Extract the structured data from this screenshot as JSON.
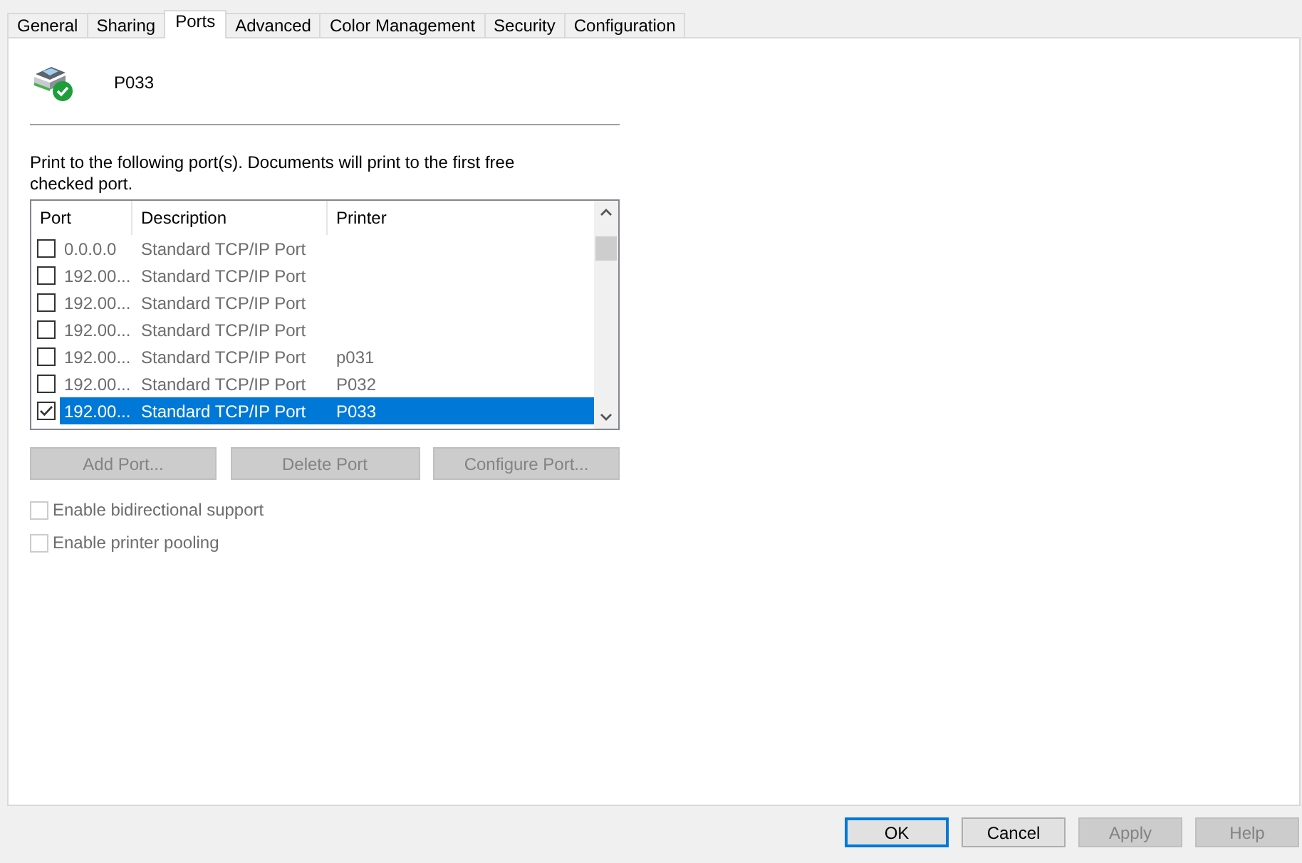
{
  "tabs": [
    {
      "label": "General",
      "selected": false
    },
    {
      "label": "Sharing",
      "selected": false
    },
    {
      "label": "Ports",
      "selected": true
    },
    {
      "label": "Advanced",
      "selected": false
    },
    {
      "label": "Color Management",
      "selected": false
    },
    {
      "label": "Security",
      "selected": false
    },
    {
      "label": "Configuration",
      "selected": false
    }
  ],
  "printer_name": "P033",
  "instruction": "Print to the following port(s). Documents will print to the first free checked port.",
  "port_list": {
    "columns": [
      "Port",
      "Description",
      "Printer"
    ],
    "rows": [
      {
        "port": "0.0.0.0",
        "description": "Standard TCP/IP Port",
        "checked": false,
        "selected": false
      },
      {
        "port": "192.00...",
        "description": "Standard TCP/IP Port",
        "checked": false,
        "selected": false
      },
      {
        "port": "192.00...",
        "description": "Standard TCP/IP Port",
        "checked": false,
        "selected": false
      },
      {
        "port": "192.00...",
        "description": "Standard TCP/IP Port",
        "checked": false,
        "selected": false
      },
      {
        "port": "192.00...",
        "description": "Standard TCP/IP Port",
        "printer": "p031",
        "checked": false,
        "selected": false
      },
      {
        "port": "192.00...",
        "description": "Standard TCP/IP Port",
        "printer": "P032",
        "checked": false,
        "selected": false
      },
      {
        "port": "192.00...",
        "description": "Standard TCP/IP Port",
        "printer": "P033",
        "checked": true,
        "selected": true
      }
    ]
  },
  "port_buttons": [
    {
      "label": "Add Port...",
      "disabled": true
    },
    {
      "label": "Delete Port",
      "disabled": true
    },
    {
      "label": "Configure Port...",
      "disabled": true
    }
  ],
  "options": [
    {
      "label": "Enable bidirectional support",
      "checked": false,
      "disabled": true
    },
    {
      "label": "Enable printer pooling",
      "checked": false,
      "disabled": true
    }
  ],
  "dialog_buttons": [
    {
      "label": "OK",
      "disabled": false,
      "default": true
    },
    {
      "label": "Cancel",
      "disabled": false,
      "default": false
    },
    {
      "label": "Apply",
      "disabled": true,
      "default": false
    },
    {
      "label": "Help",
      "disabled": true,
      "default": false
    }
  ]
}
